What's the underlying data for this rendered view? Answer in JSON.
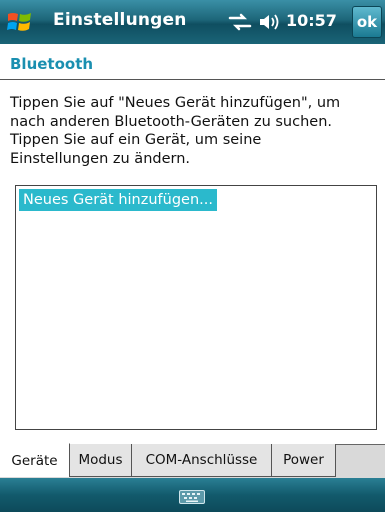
{
  "titlebar": {
    "title": "Einstellungen",
    "time": "10:57",
    "ok_label": "ok",
    "icons": [
      "windows-start-icon",
      "connectivity-icon",
      "volume-icon"
    ]
  },
  "section": {
    "title": "Bluetooth"
  },
  "instructions": {
    "lines": [
      "Tippen Sie auf \"Neues Gerät hinzufügen\", um",
      "nach anderen Bluetooth-Geräten zu suchen.",
      "Tippen Sie auf ein Gerät, um seine",
      "Einstellungen zu ändern."
    ]
  },
  "device_list": {
    "items": [
      "Neues Gerät hinzufügen..."
    ]
  },
  "tabs": [
    {
      "label": "Geräte",
      "active": true
    },
    {
      "label": "Modus",
      "active": false
    },
    {
      "label": "COM-Anschlüsse",
      "active": false
    },
    {
      "label": "Power",
      "active": false
    }
  ],
  "bottombar": {
    "icons": [
      "keyboard-icon"
    ]
  },
  "colors": {
    "accent": "#1a8fb0",
    "selection": "#2bb9cc",
    "titlebar": "#1d6679"
  }
}
